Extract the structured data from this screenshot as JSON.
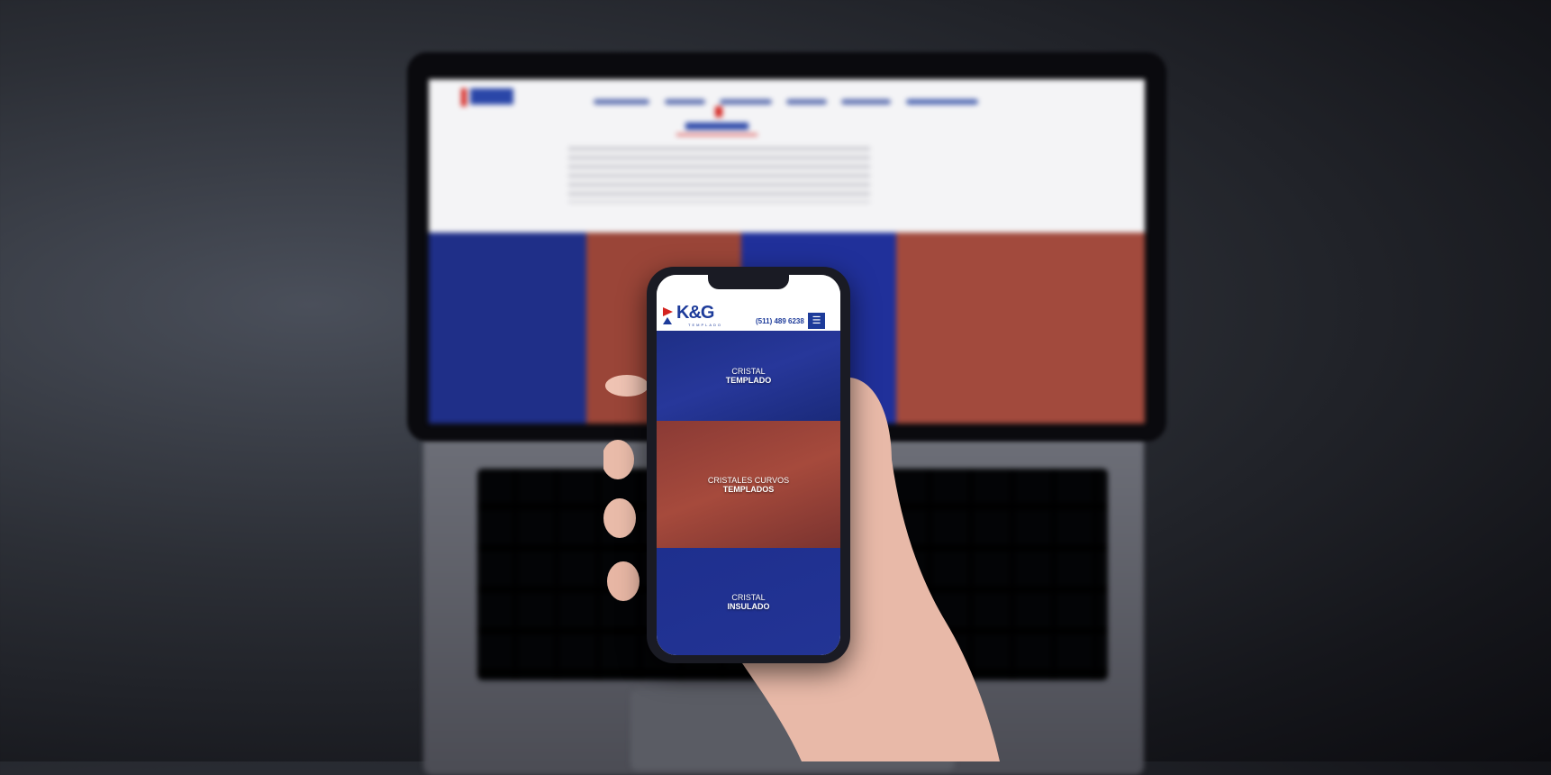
{
  "phone": {
    "logo": "K&G",
    "logo_sub": "TEMPLADO",
    "phone_number": "(511) 489 6238",
    "menu_icon": "hamburger-icon",
    "sections": [
      {
        "line1": "CRISTAL",
        "line2": "TEMPLADO"
      },
      {
        "line1": "CRISTALES CURVOS",
        "line2": "TEMPLADOS"
      },
      {
        "line1": "CRISTAL",
        "line2": "INSULADO"
      }
    ]
  },
  "colors": {
    "brand_blue": "#1d3b9a",
    "brand_red": "#d4231f",
    "tile_red": "#a64a3c"
  }
}
